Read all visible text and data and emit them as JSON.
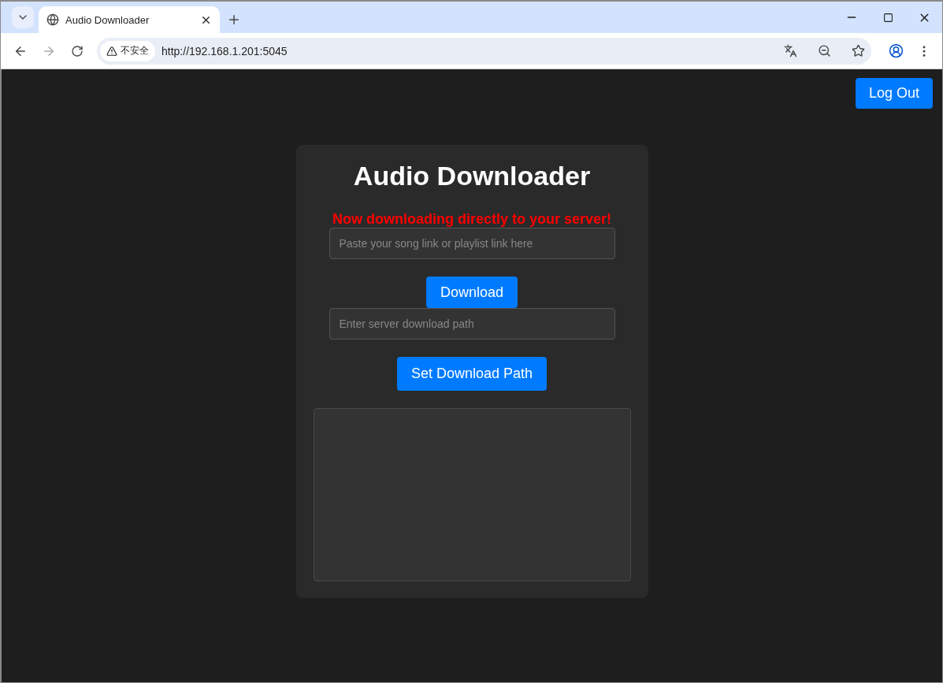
{
  "browser": {
    "tab_title": "Audio Downloader",
    "security_label": "不安全",
    "url": "http://192.168.1.201:5045"
  },
  "page": {
    "logout": "Log Out",
    "title": "Audio Downloader",
    "notice": "Now downloading directly to your server!",
    "link_field": {
      "placeholder": "Paste your song link or playlist link here"
    },
    "download_button": "Download",
    "path_field": {
      "placeholder": "Enter server download path"
    },
    "path_button": "Set Download Path"
  }
}
